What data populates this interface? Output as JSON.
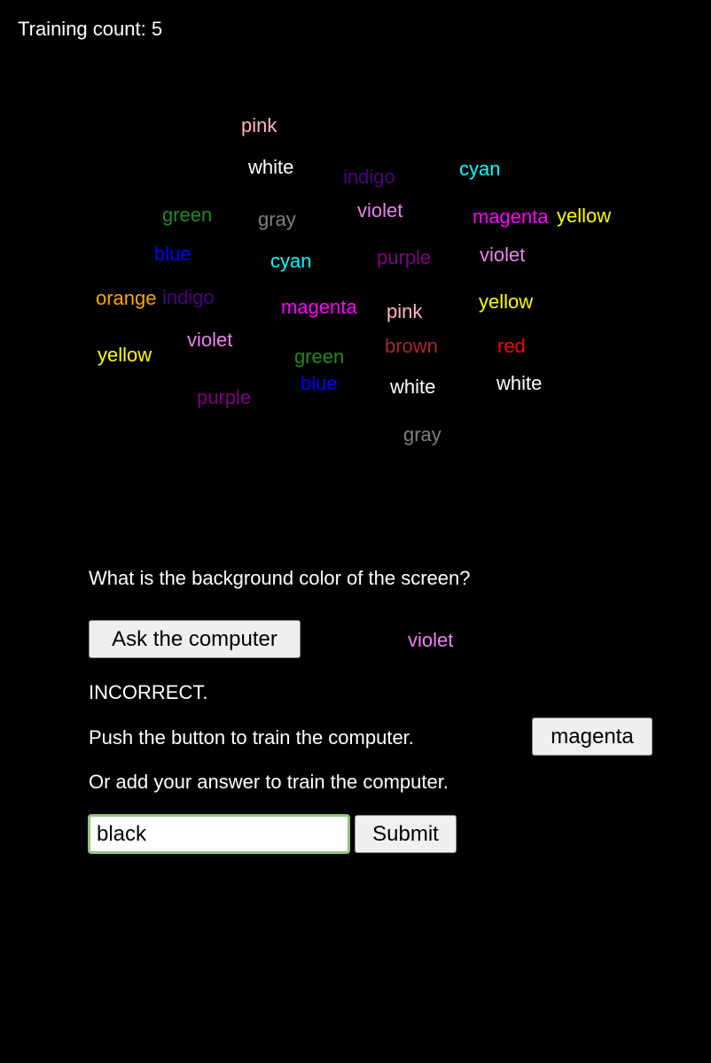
{
  "training_count_label": "Training count: 5",
  "word_cloud": [
    {
      "text": "pink",
      "color": "#ffb6c1"
    },
    {
      "text": "white",
      "color": "#ffffff"
    },
    {
      "text": "indigo",
      "color": "#4b0082"
    },
    {
      "text": "cyan",
      "color": "#00ffff"
    },
    {
      "text": "green",
      "color": "#228b22"
    },
    {
      "text": "gray",
      "color": "#808080"
    },
    {
      "text": "violet",
      "color": "#ee82ee"
    },
    {
      "text": "magenta",
      "color": "#ff00ff"
    },
    {
      "text": "yellow",
      "color": "#ffff00"
    },
    {
      "text": "blue",
      "color": "#0000ff"
    },
    {
      "text": "cyan",
      "color": "#00ffff"
    },
    {
      "text": "purple",
      "color": "#800080"
    },
    {
      "text": "violet",
      "color": "#ee82ee"
    },
    {
      "text": "orange",
      "color": "#ffa500"
    },
    {
      "text": "indigo",
      "color": "#4b0082"
    },
    {
      "text": "magenta",
      "color": "#ff00ff"
    },
    {
      "text": "pink",
      "color": "#ffb6c1"
    },
    {
      "text": "yellow",
      "color": "#ffff00"
    },
    {
      "text": "yellow",
      "color": "#ffff00"
    },
    {
      "text": "violet",
      "color": "#ee82ee"
    },
    {
      "text": "green",
      "color": "#228b22"
    },
    {
      "text": "brown",
      "color": "#a52a2a"
    },
    {
      "text": "red",
      "color": "#ff0000"
    },
    {
      "text": "purple",
      "color": "#800080"
    },
    {
      "text": "blue",
      "color": "#0000ff"
    },
    {
      "text": "white",
      "color": "#ffffff"
    },
    {
      "text": "white",
      "color": "#ffffff"
    },
    {
      "text": "gray",
      "color": "#808080"
    }
  ],
  "question": "What is the background color of the screen?",
  "ask_button_label": "Ask the computer",
  "computer_answer": {
    "text": "violet",
    "color": "#ee82ee"
  },
  "result_text": "INCORRECT.",
  "train_prompt": "Push the button to train the computer.",
  "train_button_label": "magenta",
  "add_answer_prompt": "Or add your answer to train the computer.",
  "answer_input_value": "black",
  "submit_button_label": "Submit"
}
